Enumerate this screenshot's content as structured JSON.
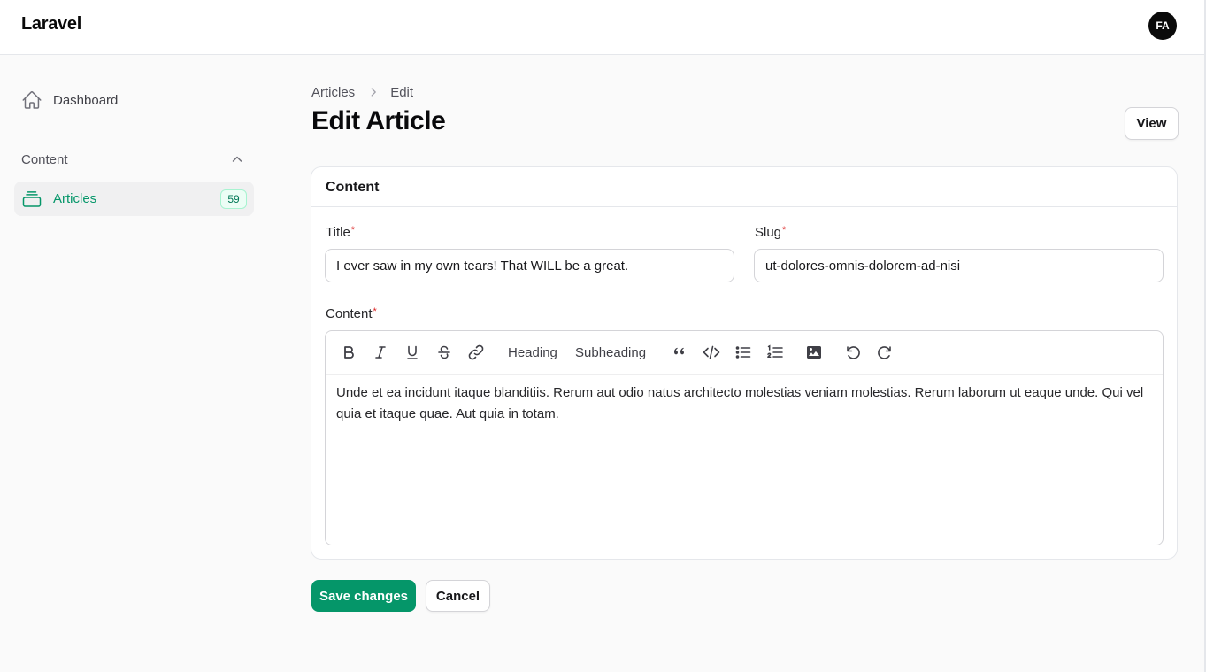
{
  "app": {
    "brand": "Laravel",
    "user_initials": "FA"
  },
  "sidebar": {
    "dashboard_label": "Dashboard",
    "group_label": "Content",
    "articles_label": "Articles",
    "articles_count": "59"
  },
  "breadcrumb": {
    "parent": "Articles",
    "current": "Edit"
  },
  "page": {
    "title": "Edit Article",
    "view_label": "View"
  },
  "form": {
    "section_title": "Content",
    "title_label": "Title",
    "title_value": "I ever saw in my own tears! That WILL be a great.",
    "slug_label": "Slug",
    "slug_value": "ut-dolores-omnis-dolorem-ad-nisi",
    "content_label": "Content",
    "required_mark": "*",
    "toolbar": {
      "heading": "Heading",
      "subheading": "Subheading"
    },
    "content_value": "Unde et ea incidunt itaque blanditiis. Rerum aut odio natus architecto molestias veniam molestias. Rerum laborum ut eaque unde. Qui vel quia et itaque quae. Aut quia in totam."
  },
  "actions": {
    "save_label": "Save changes",
    "cancel_label": "Cancel"
  },
  "colors": {
    "primary": "#059669",
    "danger": "#dc2626"
  }
}
